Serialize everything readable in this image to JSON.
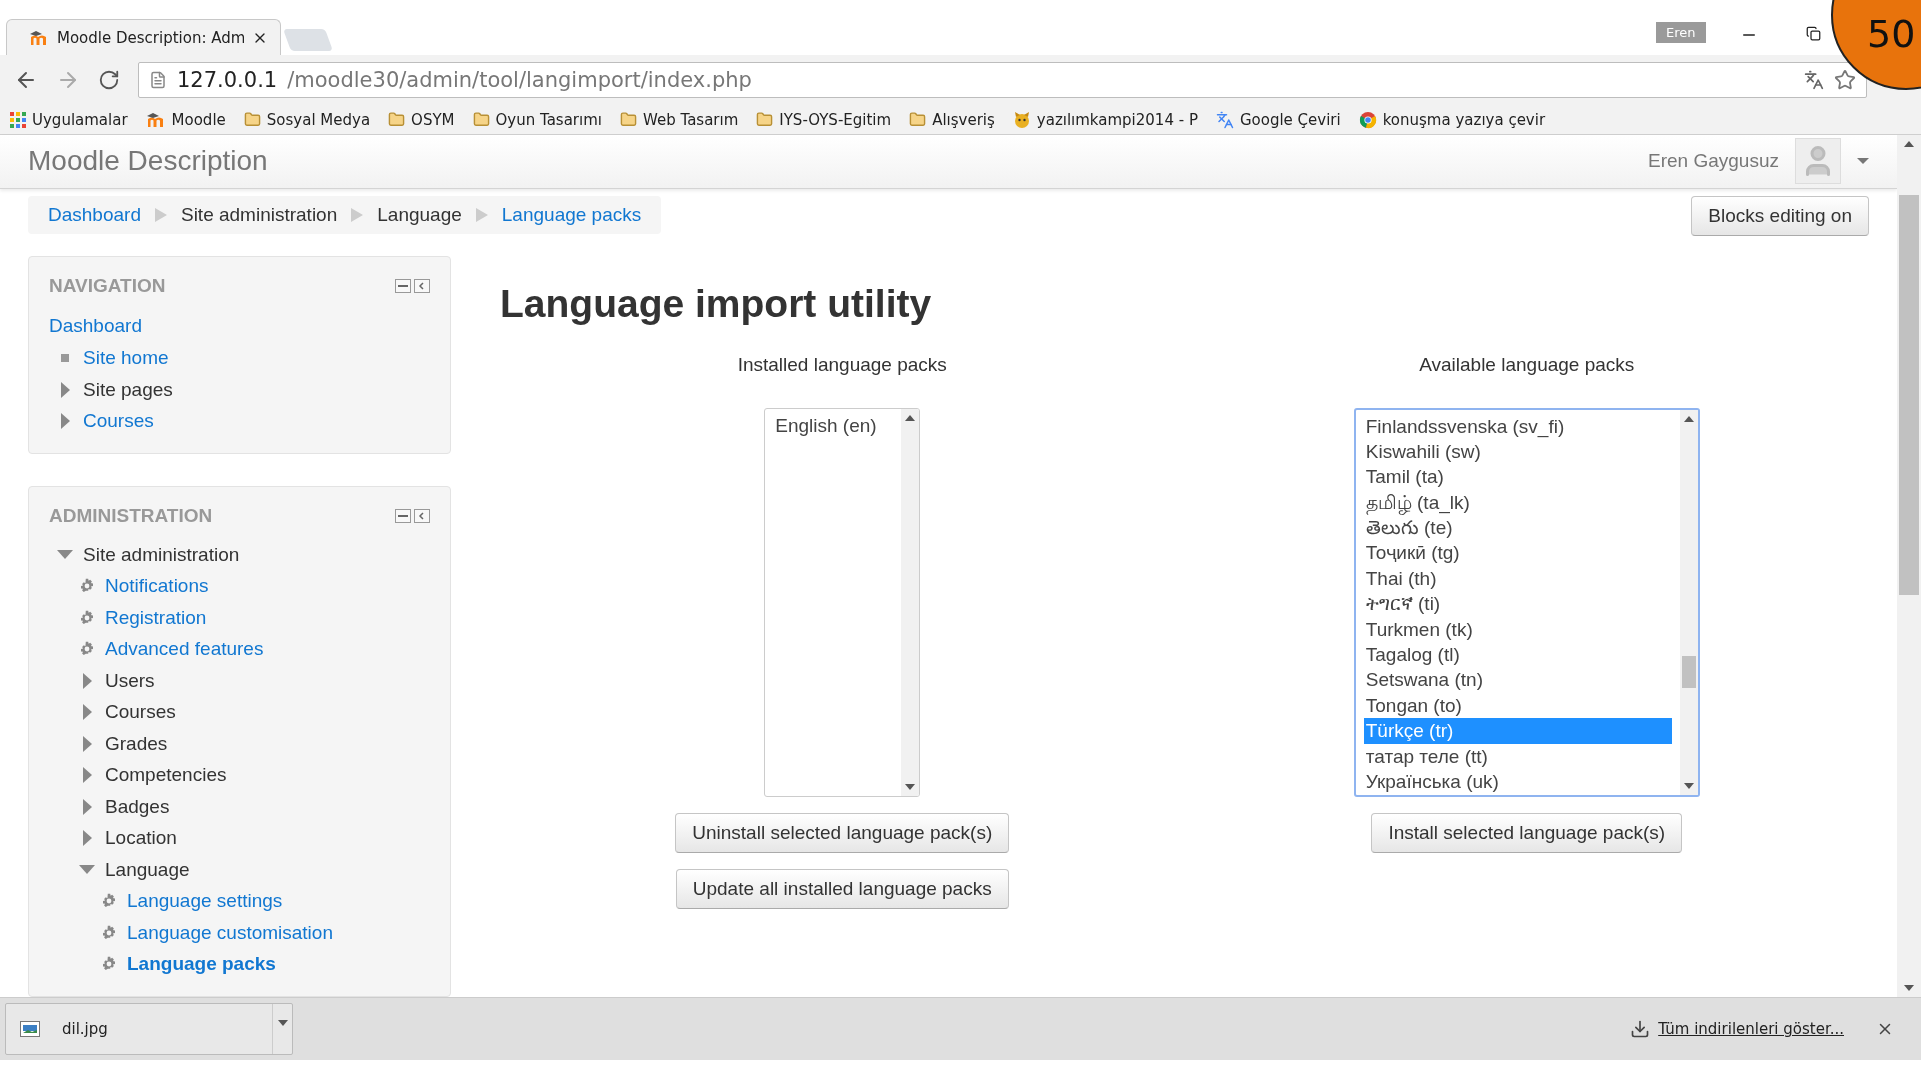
{
  "browser": {
    "tab": {
      "title": "Moodle Description: Adm"
    },
    "profile": "Eren",
    "address": {
      "host": "127.0.0.1",
      "path": "/moodle30/admin/tool/langimport/index.php"
    },
    "bookmarks": [
      {
        "label": "Uygulamalar",
        "kind": "apps"
      },
      {
        "label": "Moodle",
        "kind": "moodle"
      },
      {
        "label": "Sosyal Medya",
        "kind": "folder"
      },
      {
        "label": "OSYM",
        "kind": "folder"
      },
      {
        "label": "Oyun Tasarımı",
        "kind": "folder"
      },
      {
        "label": "Web Tasarım",
        "kind": "folder"
      },
      {
        "label": "IYS-OYS-Egitim",
        "kind": "folder"
      },
      {
        "label": "Alışveriş",
        "kind": "folder"
      },
      {
        "label": "yazılımkampi2014 - P",
        "kind": "cat"
      },
      {
        "label": "Google Çeviri",
        "kind": "translate"
      },
      {
        "label": "konuşma yazıya çevir",
        "kind": "chrome"
      }
    ]
  },
  "overlay_badge": "50",
  "header": {
    "site_name": "Moodle Description",
    "user": "Eren Gaygusuz"
  },
  "breadcrumb": [
    {
      "label": "Dashboard",
      "link": true
    },
    {
      "label": "Site administration",
      "link": false
    },
    {
      "label": "Language",
      "link": false
    },
    {
      "label": "Language packs",
      "link": true
    }
  ],
  "blocks_button": "Blocks editing on",
  "blocks": [
    {
      "title": "NAVIGATION",
      "items": [
        {
          "label": "Dashboard",
          "kind": "plain",
          "link": true,
          "current": false,
          "children": [
            {
              "label": "Site home",
              "kind": "bullet",
              "link": true,
              "current": false
            },
            {
              "label": "Site pages",
              "kind": "branch",
              "expanded": false,
              "link": false,
              "current": false
            },
            {
              "label": "Courses",
              "kind": "branch",
              "expanded": false,
              "link": true,
              "current": false
            }
          ]
        }
      ]
    },
    {
      "title": "ADMINISTRATION",
      "items": [
        {
          "label": "Site administration",
          "kind": "branch",
          "expanded": true,
          "link": false,
          "current": false,
          "children": [
            {
              "label": "Notifications",
              "kind": "setting",
              "link": true,
              "current": false
            },
            {
              "label": "Registration",
              "kind": "setting",
              "link": true,
              "current": false
            },
            {
              "label": "Advanced features",
              "kind": "setting",
              "link": true,
              "current": false
            },
            {
              "label": "Users",
              "kind": "branch",
              "expanded": false,
              "link": false,
              "current": false
            },
            {
              "label": "Courses",
              "kind": "branch",
              "expanded": false,
              "link": false,
              "current": false
            },
            {
              "label": "Grades",
              "kind": "branch",
              "expanded": false,
              "link": false,
              "current": false
            },
            {
              "label": "Competencies",
              "kind": "branch",
              "expanded": false,
              "link": false,
              "current": false
            },
            {
              "label": "Badges",
              "kind": "branch",
              "expanded": false,
              "link": false,
              "current": false
            },
            {
              "label": "Location",
              "kind": "branch",
              "expanded": false,
              "link": false,
              "current": false
            },
            {
              "label": "Language",
              "kind": "branch",
              "expanded": true,
              "link": false,
              "current": false,
              "children": [
                {
                  "label": "Language settings",
                  "kind": "setting",
                  "link": true,
                  "current": false
                },
                {
                  "label": "Language customisation",
                  "kind": "setting",
                  "link": true,
                  "current": false
                },
                {
                  "label": "Language packs",
                  "kind": "setting",
                  "link": true,
                  "current": true
                }
              ]
            }
          ]
        }
      ]
    }
  ],
  "main": {
    "title": "Language import utility",
    "installed": {
      "label": "Installed language packs",
      "options": [
        {
          "label": "English (en)",
          "selected": false
        }
      ],
      "buttons": [
        "Uninstall selected language pack(s)",
        "Update all installed language packs"
      ]
    },
    "available": {
      "label": "Available language packs",
      "options": [
        {
          "label": "Finlandssvenska (sv_fi)",
          "selected": false
        },
        {
          "label": "Kiswahili (sw)",
          "selected": false
        },
        {
          "label": "Tamil (ta)",
          "selected": false
        },
        {
          "label": "தமிழ் (ta_lk)",
          "selected": false
        },
        {
          "label": "తెలుగు (te)",
          "selected": false
        },
        {
          "label": "Тоҷикӣ (tg)",
          "selected": false
        },
        {
          "label": "Thai (th)",
          "selected": false
        },
        {
          "label": "ትግርኛ (ti)",
          "selected": false
        },
        {
          "label": "Turkmen (tk)",
          "selected": false
        },
        {
          "label": "Tagalog (tl)",
          "selected": false
        },
        {
          "label": "Setswana (tn)",
          "selected": false
        },
        {
          "label": "Tongan (to)",
          "selected": false
        },
        {
          "label": "Türkçe (tr)",
          "selected": true
        },
        {
          "label": "татар теле (tt)",
          "selected": false
        },
        {
          "label": "Українська (uk)",
          "selected": false
        }
      ],
      "buttons": [
        "Install selected language pack(s)"
      ]
    }
  },
  "downloads": {
    "file": "dil.jpg",
    "show_all": "Tüm indirilenleri göster..."
  }
}
